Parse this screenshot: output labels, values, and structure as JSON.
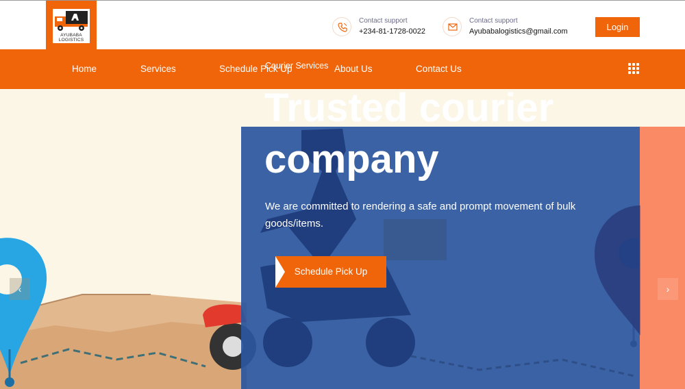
{
  "brand": {
    "logo_text_line1": "AYUBABA",
    "logo_text_line2": "LOGISTICS",
    "logo_icon": "truck-icon",
    "accent_color": "#f0650a"
  },
  "header": {
    "phone": {
      "label": "Contact support",
      "value": "+234-81-1728-0022",
      "icon": "phone-icon"
    },
    "email": {
      "label": "Contact support",
      "value": "Ayubabalogistics@gmail.com",
      "icon": "mail-icon"
    },
    "login_label": "Login"
  },
  "nav": {
    "items": [
      {
        "label": "Home"
      },
      {
        "label": "Services"
      },
      {
        "label": "Schedule Pick Up"
      },
      {
        "label": "About Us"
      },
      {
        "label": "Contact Us"
      }
    ],
    "menu_icon": "grid-menu-icon"
  },
  "hero": {
    "kicker": "Courier Services",
    "headline": "Trusted courier company",
    "subtext": "We are committed to rendering a safe and prompt movement of bulk goods/items.",
    "cta_label": "Schedule Pick Up",
    "prev_icon": "chevron-left-icon",
    "next_icon": "chevron-right-icon",
    "panel_color": "#2b569e"
  }
}
